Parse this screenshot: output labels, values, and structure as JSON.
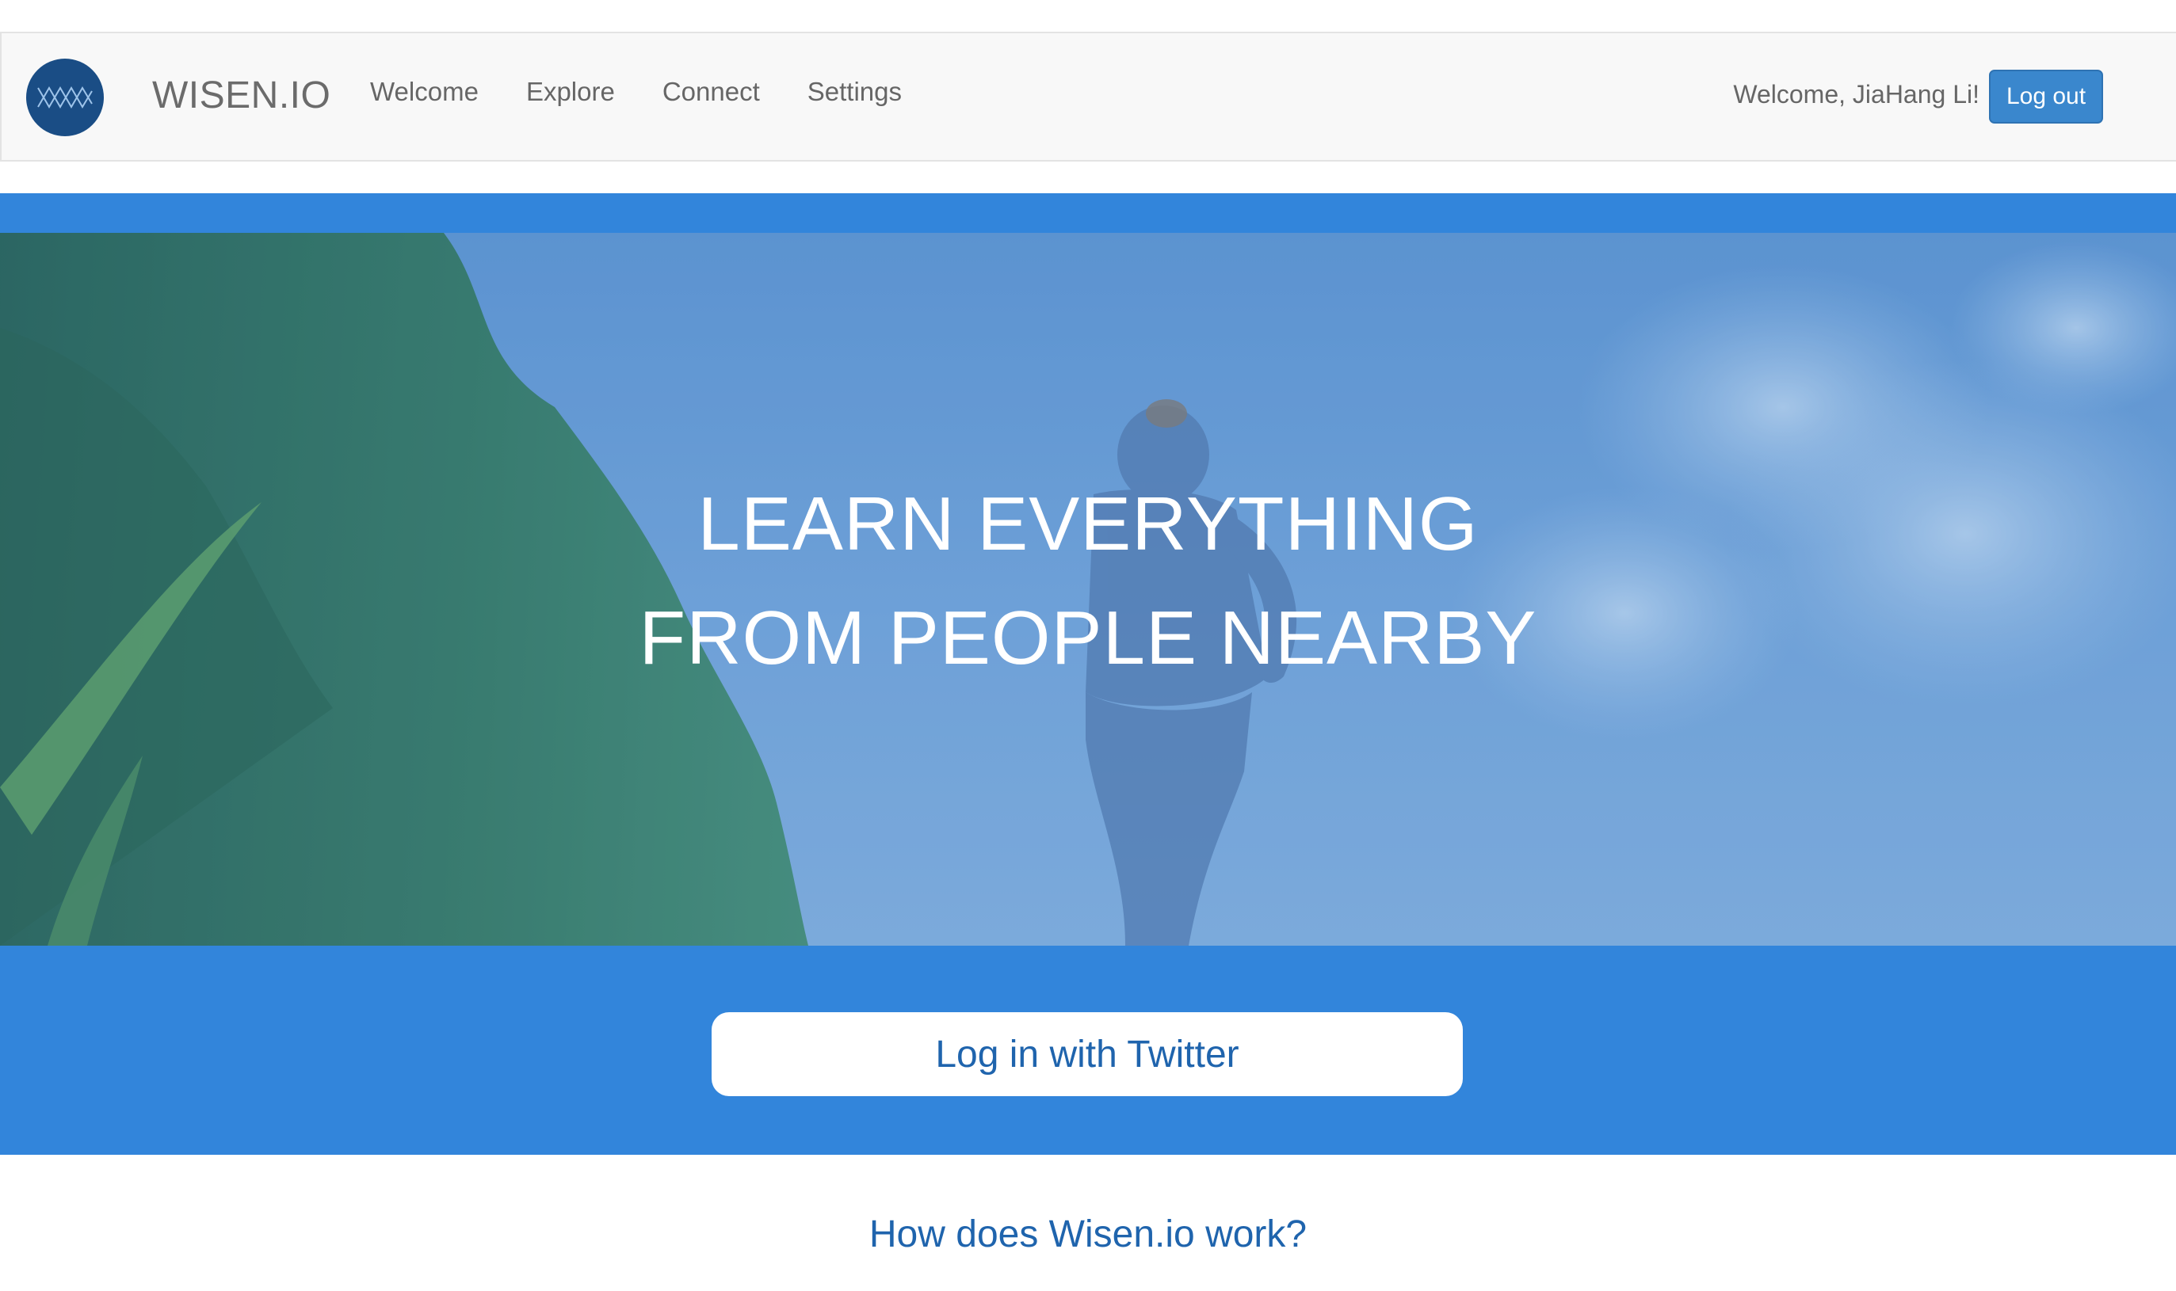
{
  "navbar": {
    "brand": "WISEN.IO",
    "links": [
      "Welcome",
      "Explore",
      "Connect",
      "Settings"
    ],
    "welcome_text": "Welcome, JiaHang Li!",
    "logout_label": "Log out"
  },
  "hero": {
    "line1": "LEARN EVERYTHING",
    "line2": "FROM PEOPLE NEARBY",
    "twitter_button_label": "Log in with Twitter"
  },
  "section": {
    "heading": "How does Wisen.io work?"
  },
  "colors": {
    "accent_blue": "#3285db",
    "button_blue": "#3a87cd",
    "link_blue": "#1f64ad",
    "logo_navy": "#1a4d85"
  }
}
